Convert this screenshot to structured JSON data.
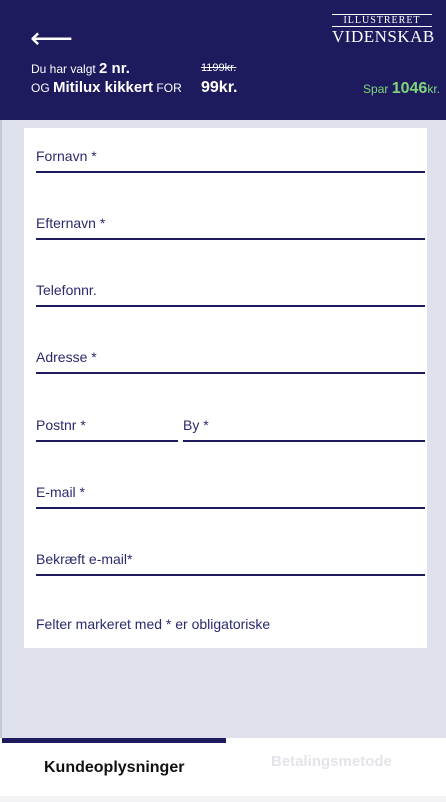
{
  "header": {
    "back_glyph": "⟵",
    "logo_line1": "ILLUSTRERET",
    "logo_line2": "VIDENSKAB",
    "selected_prefix": "Du har valgt",
    "selected_count": "2 nr.",
    "old_price": "1199kr.",
    "og_label": "OG",
    "product_name": "Mitilux kikkert",
    "for_label": "FOR",
    "new_price": "99kr.",
    "save_label": "Spar",
    "save_amount": "1046",
    "save_unit": "kr."
  },
  "form": {
    "fields": [
      {
        "label": "Fornavn *"
      },
      {
        "label": "Efternavn *"
      },
      {
        "label": "Telefonnr."
      },
      {
        "label": "Adresse *"
      },
      {
        "label": "Postnr *"
      },
      {
        "label": "By *"
      },
      {
        "label": "E-mail *"
      },
      {
        "label": "Bekræft e-mail*"
      }
    ],
    "required_note": "Felter markeret med * er obligatoriske"
  },
  "tabs": {
    "customer_info": "Kundeoplysninger",
    "payment_method": "Betalingsmetode"
  },
  "colors": {
    "brand": "#1e1a5e",
    "save_green": "#7fd67a",
    "background": "#dfe1ec"
  }
}
